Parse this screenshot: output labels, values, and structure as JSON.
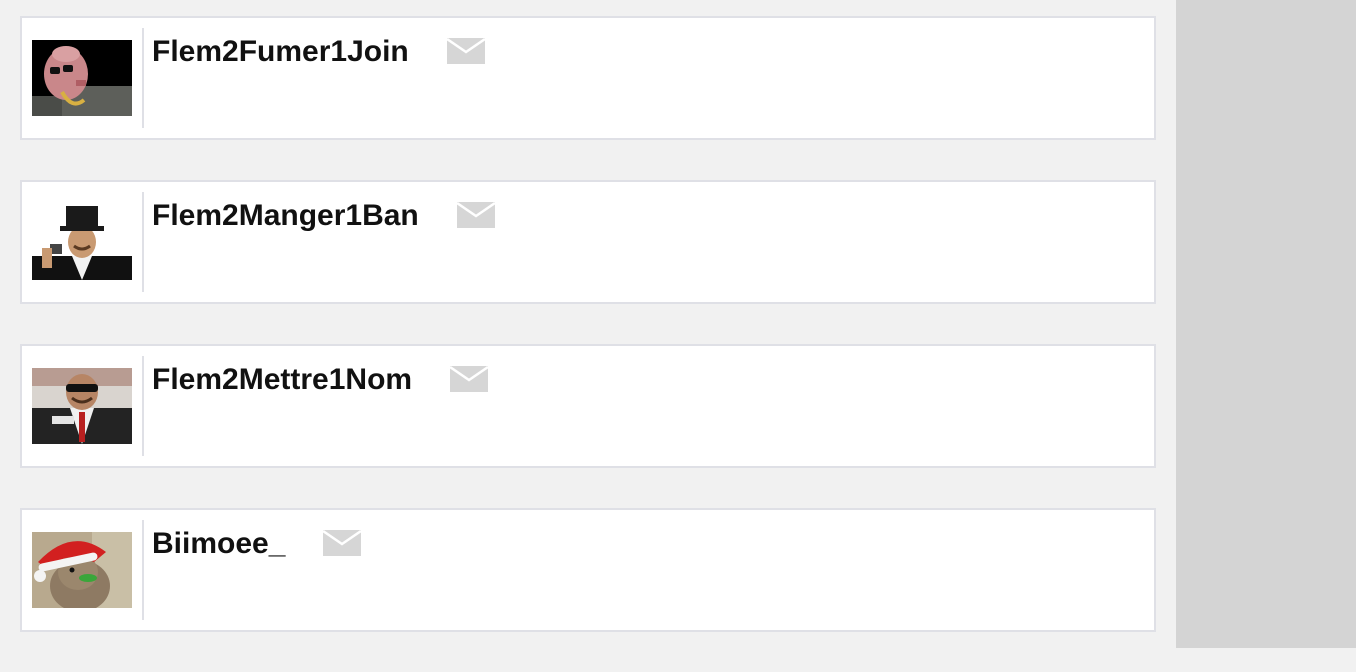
{
  "colors": {
    "page_background": "#f1f1f1",
    "right_panel": "#d4d4d4",
    "card_background": "#ffffff",
    "card_border": "#dfe0e6",
    "mail_icon": "#d6d6d6"
  },
  "users": [
    {
      "username": "Flem2Fumer1Join",
      "avatar_icon": "avatar-bald-man-sunglasses-gold-chain",
      "action_icon": "mail-icon"
    },
    {
      "username": "Flem2Manger1Ban",
      "avatar_icon": "avatar-laughing-man-top-hat",
      "action_icon": "mail-icon"
    },
    {
      "username": "Flem2Mettre1Nom",
      "avatar_icon": "avatar-laughing-man-sunglasses-suit",
      "action_icon": "mail-icon"
    },
    {
      "username": "Biimoee_",
      "avatar_icon": "avatar-quokka-santa-hat",
      "action_icon": "mail-icon"
    }
  ]
}
